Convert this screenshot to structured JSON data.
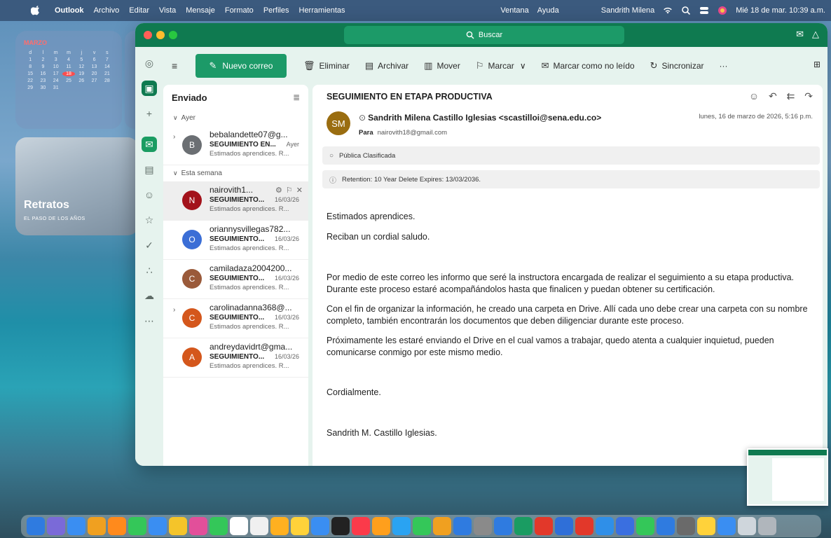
{
  "menubar": {
    "items": [
      "Outlook",
      "Archivo",
      "Editar",
      "Vista",
      "Mensaje",
      "Formato",
      "Perfiles",
      "Herramientas"
    ],
    "right_items": [
      "Ventana",
      "Ayuda",
      "Sandrith Milena"
    ],
    "clock": "Mié 18 de mar. 10:39 a.m."
  },
  "widgets": {
    "calendar_month": "MARZO",
    "calendar_days": [
      "d",
      "l",
      "m",
      "m",
      "j",
      "v",
      "s",
      "1",
      "2",
      "3",
      "4",
      "5",
      "6",
      "7",
      "8",
      "9",
      "10",
      "11",
      "12",
      "13",
      "14",
      "15",
      "16",
      "17",
      "18",
      "19",
      "20",
      "21",
      "22",
      "23",
      "24",
      "25",
      "26",
      "27",
      "28",
      "29",
      "30",
      "31"
    ],
    "calendar_today": "18",
    "photo_title": "Retratos",
    "photo_subtitle": "EL PASO DE LOS AÑOS"
  },
  "window": {
    "search_placeholder": "Buscar"
  },
  "toolbar": {
    "new_mail": "Nuevo correo",
    "delete": "Eliminar",
    "archive": "Archivar",
    "move": "Mover",
    "flag": "Marcar",
    "mark_unread": "Marcar como no leído",
    "sync": "Sincronizar",
    "more": "···"
  },
  "list": {
    "folder": "Enviado",
    "groups": {
      "yesterday": "Ayer",
      "this_week": "Esta semana"
    },
    "items": [
      {
        "initial": "B",
        "color": "#6b6f73",
        "sender": "bebalandette07@g...",
        "subject": "SEGUIMIENTO EN...",
        "date": "Ayer",
        "preview": "Estimados aprendices. R..."
      },
      {
        "initial": "N",
        "color": "#a3121b",
        "sender": "nairovith1...",
        "subject": "SEGUIMIENTO...",
        "date": "16/03/26",
        "preview": "Estimados aprendices. R..."
      },
      {
        "initial": "O",
        "color": "#3b6ed6",
        "sender": "oriannysvillegas782...",
        "subject": "SEGUIMIENTO...",
        "date": "16/03/26",
        "preview": "Estimados aprendices. R..."
      },
      {
        "initial": "C",
        "color": "#9a5a3a",
        "sender": "camiladaza2004200...",
        "subject": "SEGUIMIENTO...",
        "date": "16/03/26",
        "preview": "Estimados aprendices. R..."
      },
      {
        "initial": "C",
        "color": "#d4571c",
        "sender": "carolinadanna368@...",
        "subject": "SEGUIMIENTO...",
        "date": "16/03/26",
        "preview": "Estimados aprendices. R..."
      },
      {
        "initial": "A",
        "color": "#d4571c",
        "sender": "andreydavidrt@gma...",
        "subject": "SEGUIMIENTO...",
        "date": "16/03/26",
        "preview": "Estimados aprendices. R..."
      }
    ]
  },
  "message": {
    "subject": "SEGUIMIENTO EN ETAPA PRODUCTIVA",
    "sender_initials": "SM",
    "sender": "Sandrith Milena Castillo Iglesias <scastilloi@sena.edu.co>",
    "date": "lunes, 16 de marzo de 2026, 5:16 p.m.",
    "to_label": "Para",
    "to": "nairovith18@gmail.com",
    "classification": "Pública Clasificada",
    "retention": "Retention: 10 Year Delete Expires: 13/03/2036.",
    "body": [
      "Estimados aprendices.",
      "Reciban un cordial saludo.",
      "Por medio de este correo les informo que seré la instructora encargada de realizar el seguimiento a su etapa productiva. Durante este proceso estaré acompañándolos hasta que finalicen y puedan obtener su certificación.",
      "Con el fin de organizar la información, he creado una carpeta en Drive. Allí cada uno debe crear una carpeta con su nombre completo, también encontrarán los documentos que deben diligenciar durante este proceso.",
      "Próximamente les estaré enviando el Drive en el cual vamos a trabajar, quedo atenta a cualquier inquietud, pueden comunicarse conmigo por este mismo medio.",
      "Cordialmente.",
      "Sandrith M. Castillo Iglesias."
    ]
  },
  "dock": {
    "colors": [
      "#2f7be0",
      "#7a6ad8",
      "#3a8ef2",
      "#f0a020",
      "#ff8a1c",
      "#34c759",
      "#3a8ef2",
      "#f4c42a",
      "#e24f9a",
      "#34c759",
      "#ffffff",
      "#f0f0f0",
      "#ffb020",
      "#ffd23a",
      "#3a8ef2",
      "#222222",
      "#fb3a4a",
      "#ff9f1c",
      "#2aa3f2",
      "#34c759",
      "#f0a020",
      "#2f7be0",
      "#8a8a8a",
      "#2f7be0",
      "#1a9c62",
      "#e2382a",
      "#2f6fd8",
      "#e2382a",
      "#2f8fe8",
      "#3a6fe0",
      "#34c759",
      "#2f7be0",
      "#6a6a6a",
      "#ffd23a",
      "#3a8ef2",
      "#cfd6dc",
      "#b0b6bc"
    ]
  }
}
